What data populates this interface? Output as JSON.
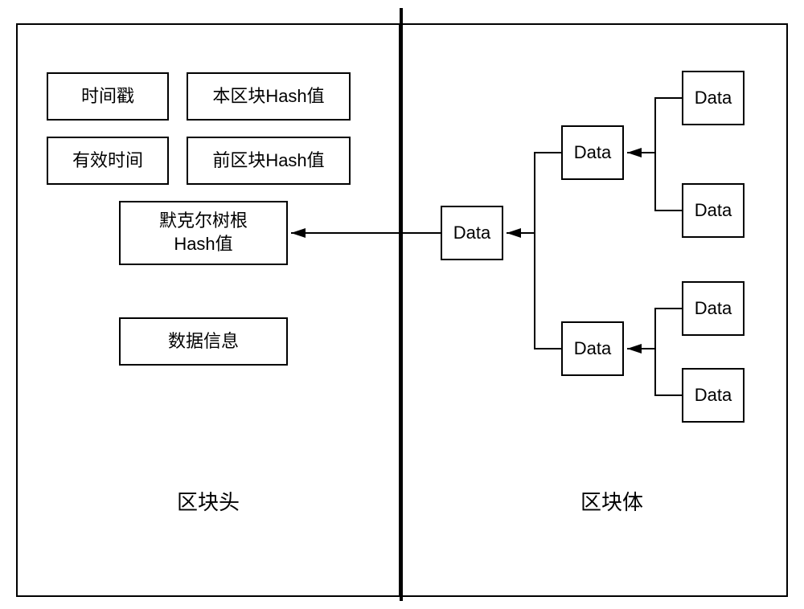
{
  "header": {
    "timestamp": "时间戳",
    "this_hash": "本区块Hash值",
    "valid_time": "有效时间",
    "prev_hash": "前区块Hash值",
    "merkle_root": "默克尔树根\nHash值",
    "data_info": "数据信息"
  },
  "body": {
    "root": "Data",
    "mid1": "Data",
    "mid2": "Data",
    "leaf1": "Data",
    "leaf2": "Data",
    "leaf3": "Data",
    "leaf4": "Data"
  },
  "labels": {
    "left": "区块头",
    "right": "区块体"
  },
  "chart_data": {
    "type": "table",
    "description": "Blockchain block structure diagram",
    "sections": [
      {
        "name": "区块头 (Block Header)",
        "fields": [
          "时间戳",
          "本区块Hash值",
          "有效时间",
          "前区块Hash值",
          "默克尔树根Hash值",
          "数据信息"
        ]
      },
      {
        "name": "区块体 (Block Body)",
        "structure": "Merkle tree",
        "nodes": [
          {
            "level": 0,
            "label": "Data",
            "children": [
              "Data",
              "Data"
            ]
          },
          {
            "level": 1,
            "label": "Data",
            "children": [
              "Data",
              "Data"
            ]
          },
          {
            "level": 1,
            "label": "Data",
            "children": [
              "Data",
              "Data"
            ]
          }
        ]
      }
    ],
    "connections": [
      "默克尔树根Hash值 ← Data(root)"
    ]
  }
}
